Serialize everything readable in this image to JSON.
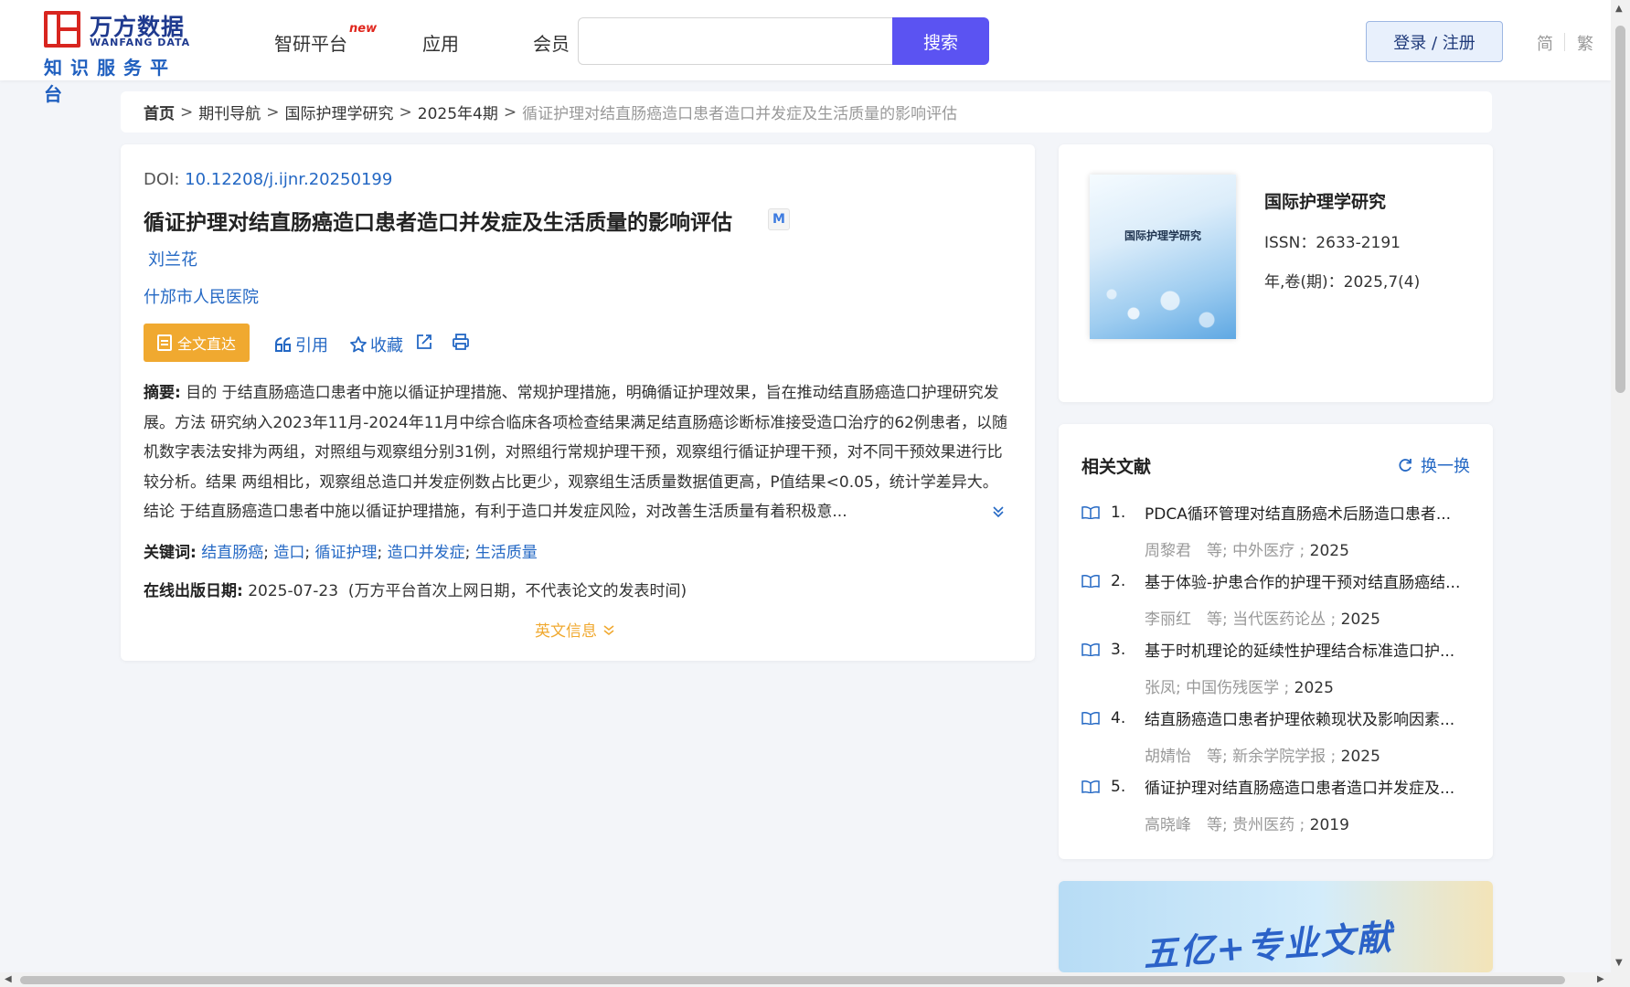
{
  "header": {
    "logo_cn": "万方数据",
    "logo_en": "WANFANG DATA",
    "logo_sub": "知识服务平台",
    "nav": [
      {
        "label": "智研平台",
        "badge": "new"
      },
      {
        "label": "应用"
      },
      {
        "label": "会员"
      }
    ],
    "search_value": "",
    "search_button": "搜索",
    "login": "登录 / 注册",
    "lang_simplified": "简",
    "lang_traditional": "繁"
  },
  "breadcrumb": {
    "items": [
      "首页",
      "期刊导航",
      "国际护理学研究",
      "2025年4期"
    ],
    "sep": ">",
    "current": "循证护理对结直肠癌造口患者造口并发症及生活质量的影响评估"
  },
  "article": {
    "doi_label": "DOI:",
    "doi": "10.12208/j.ijnr.20250199",
    "title": "循证护理对结直肠癌造口患者造口并发症及生活质量的影响评估",
    "title_badge": "M",
    "author": "刘兰花",
    "org": "什邡市人民医院",
    "fulltext_button": "全文直达",
    "actions": {
      "cite": "引用",
      "favorite": "收藏"
    },
    "abstract_label": "摘要:",
    "abstract": "目的 于结直肠癌造口患者中施以循证护理措施、常规护理措施，明确循证护理效果，旨在推动结直肠癌造口护理研究发展。方法 研究纳入2023年11月-2024年11月中综合临床各项检查结果满足结直肠癌诊断标准接受造口治疗的62例患者，以随机数字表法安排为两组，对照组与观察组分别31例，对照组行常规护理干预，观察组行循证护理干预，对不同干预效果进行比较分析。结果 两组相比，观察组总造口并发症例数占比更少，观察组生活质量数据值更高，P值结果<0.05，统计学差异大。结论 于结直肠癌造口患者中施以循证护理措施，有利于造口并发症风险，对改善生活质量有着积极意...",
    "keywords_label": "关键词:",
    "keywords": [
      "结直肠癌",
      "造口",
      "循证护理",
      "造口并发症",
      "生活质量"
    ],
    "pubdate_label": "在线出版日期:",
    "pubdate": "2025-07-23",
    "pubdate_note": "(万方平台首次上网日期，不代表论文的发表时间)",
    "english_info": "英文信息"
  },
  "journal": {
    "cover_title": "国际护理学研究",
    "name": "国际护理学研究",
    "issn": "ISSN：2633-2191",
    "volume": "年,卷(期)：2025,7(4)"
  },
  "related": {
    "title": "相关文献",
    "refresh": "换一换",
    "items": [
      {
        "num": "1.",
        "title": "PDCA循环管理对结直肠癌术后肠造口患者...",
        "meta": "周黎君　等;  中外医疗 ;",
        "year": "2025"
      },
      {
        "num": "2.",
        "title": "基于体验-护患合作的护理干预对结直肠癌结...",
        "meta": "李丽红　等;  当代医药论丛 ;",
        "year": "2025"
      },
      {
        "num": "3.",
        "title": "基于时机理论的延续性护理结合标准造口护...",
        "meta": "张凤;  中国伤残医学 ;",
        "year": "2025"
      },
      {
        "num": "4.",
        "title": "结直肠癌造口患者护理依赖现状及影响因素...",
        "meta": "胡婧怡　等;  新余学院学报 ;",
        "year": "2025"
      },
      {
        "num": "5.",
        "title": "循证护理对结直肠癌造口患者造口并发症及...",
        "meta": "高晓峰　等;  贵州医药 ;",
        "year": "2019"
      }
    ]
  },
  "banner": {
    "text": "五亿+专业文献"
  },
  "colors": {
    "accent": "#5b53f2",
    "link": "#2468c4",
    "orange": "#f0a930",
    "brand_red": "#d8251f"
  }
}
